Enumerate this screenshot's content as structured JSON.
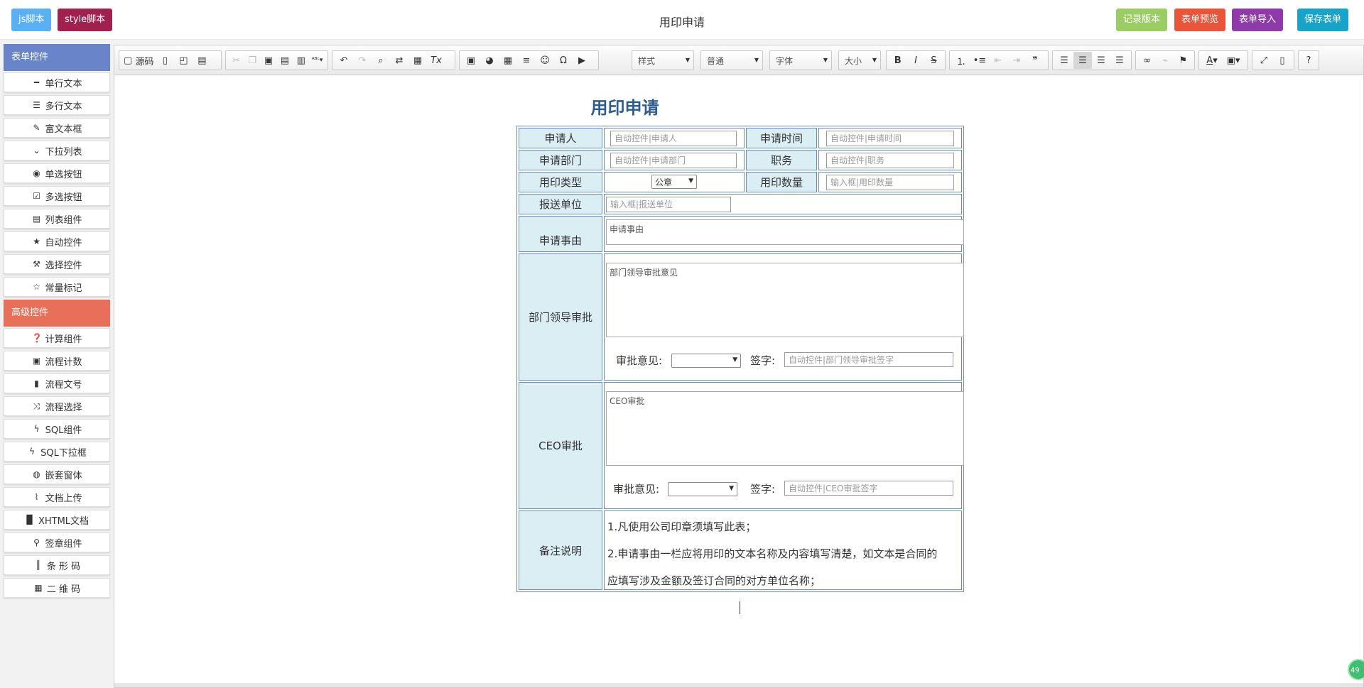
{
  "topbar": {
    "title": "用印申请",
    "buttons": {
      "js": "js脚本",
      "style": "style脚本",
      "record": "记录版本",
      "preview": "表单预览",
      "import": "表单导入",
      "save": "保存表单"
    }
  },
  "sidebar": {
    "section1": "表单控件",
    "items1": [
      "单行文本",
      "多行文本",
      "富文本框",
      "下拉列表",
      "单选按钮",
      "多选按钮",
      "列表组件",
      "自动控件",
      "选择控件",
      "常量标记"
    ],
    "section2": "高级控件",
    "items2": [
      "计算组件",
      "流程计数",
      "流程文号",
      "流程选择",
      "SQL组件",
      "SQL下拉框",
      "嵌套窗体",
      "文档上传",
      "XHTML文档",
      "签章组件",
      "条 形 码",
      "二 维 码"
    ]
  },
  "toolbar": {
    "source": "源码",
    "style_combo": "样式",
    "format_combo": "普通",
    "font_combo": "字体",
    "size_combo": "大小"
  },
  "form": {
    "title": "用印申请",
    "labels": {
      "applicant": "申请人",
      "apply_time": "申请时间",
      "department": "申请部门",
      "position": "职务",
      "seal_type": "用印类型",
      "seal_count": "用印数量",
      "send_unit": "报送单位",
      "reason": "申请事由",
      "dept_approval": "部门领导审批",
      "ceo_approval": "CEO审批",
      "remarks": "备注说明",
      "opinion": "审批意见:",
      "sign": "签字:"
    },
    "inputs": {
      "applicant": "自动控件|申请人",
      "apply_time": "自动控件|申请时间",
      "department": "自动控件|申请部门",
      "position": "自动控件|职务",
      "seal_count": "输入框|用印数量",
      "send_unit": "输入框|报送单位",
      "reason": "申请事由",
      "dept_opinion": "部门领导审批意见",
      "dept_sign": "自动控件|部门领导审批签字",
      "ceo_opinion": "CEO审批",
      "ceo_sign": "自动控件|CEO审批签字"
    },
    "seal_type_selected": "公章",
    "notes": [
      "1.凡使用公司印章须填写此表；",
      "2.申请事由一栏应将用印的文本名称及内容填写清楚，如文本是合同的",
      "应填写涉及金额及签订合同的对方单位名称；"
    ]
  },
  "badge": "49",
  "colors": {
    "js_button": "#5ab0f0",
    "style_button": "#a0214d",
    "record_button": "#9ccc65",
    "preview_button": "#e8553a",
    "import_button": "#8e3aa8",
    "save_button": "#1aa3c8",
    "section1_header": "#6a84c9",
    "section2_header": "#e8705a",
    "label_bg": "#dbeef4",
    "title_color": "#2d5c8f"
  }
}
